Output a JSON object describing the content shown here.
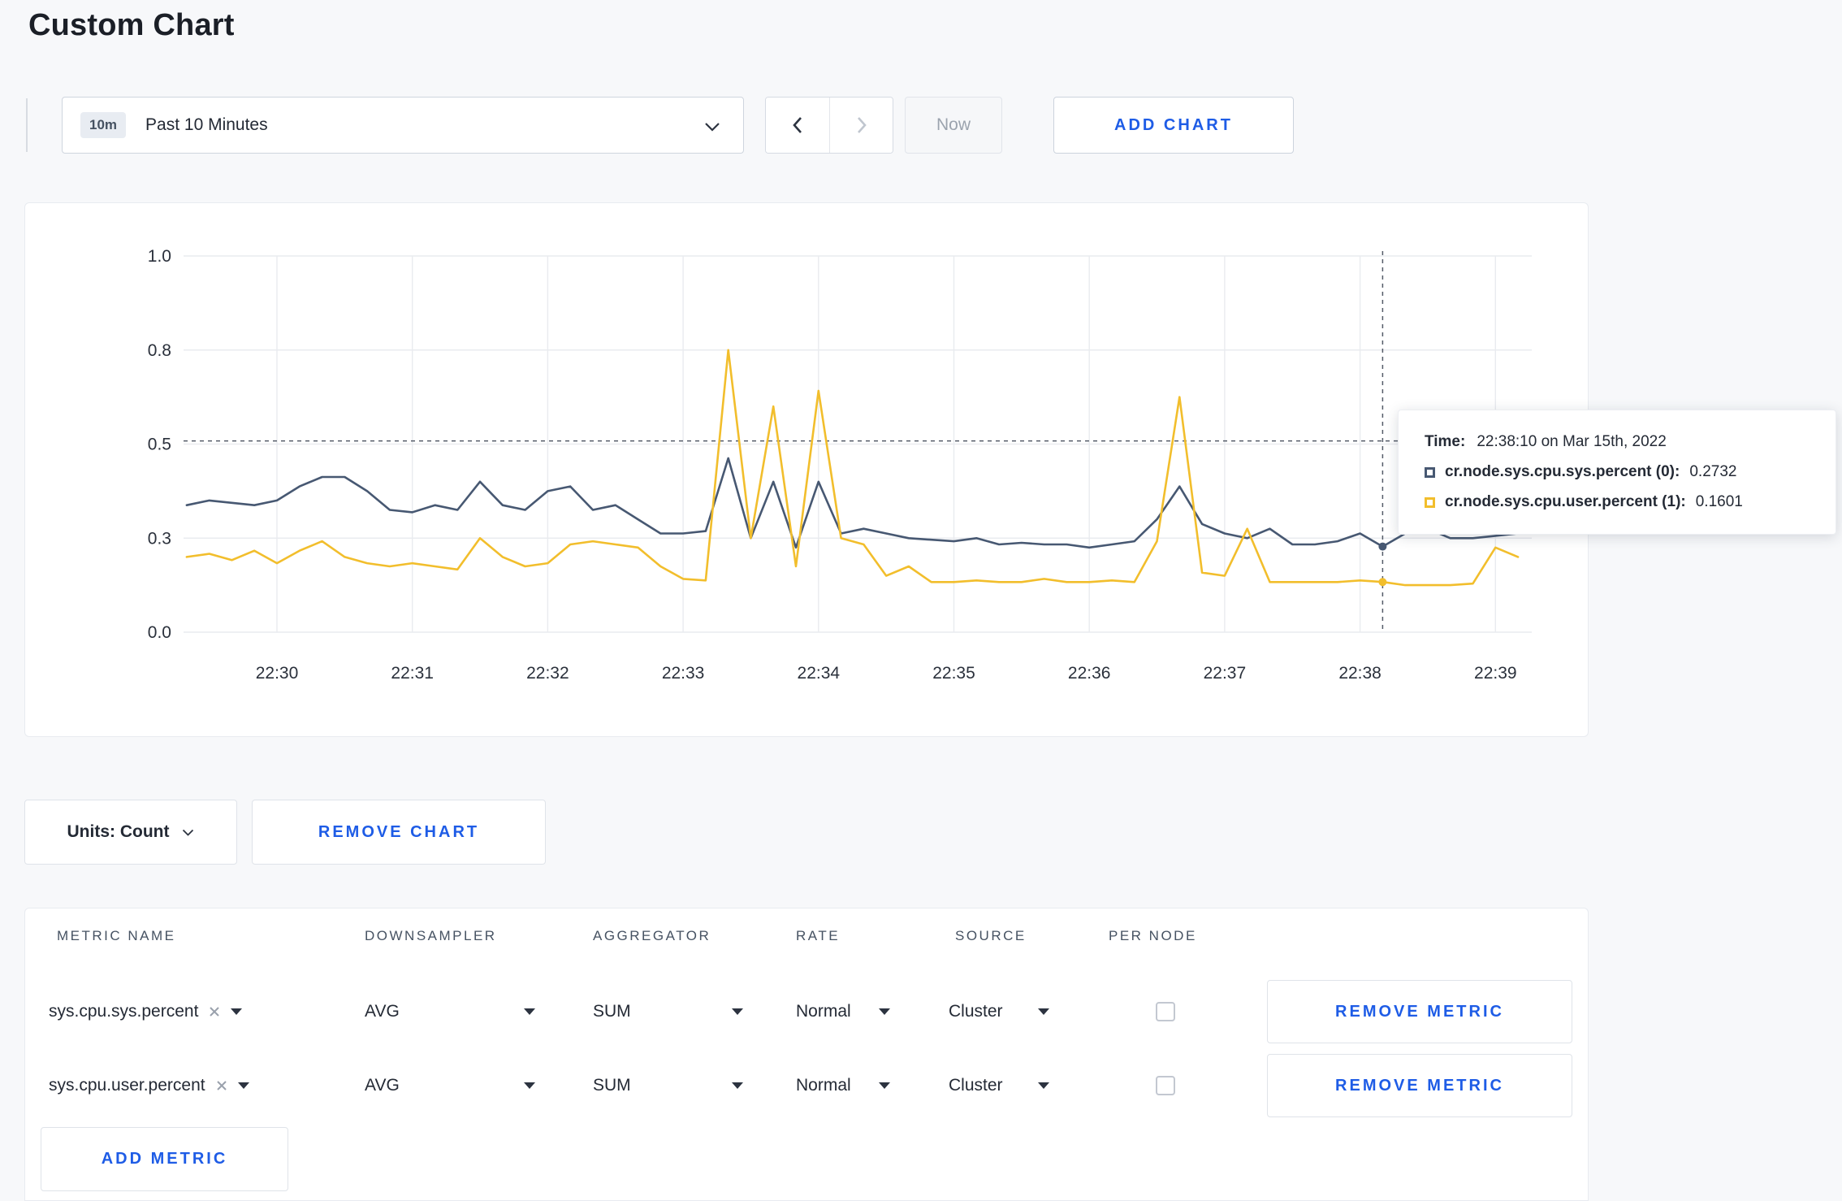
{
  "page": {
    "title": "Custom Chart"
  },
  "colors": {
    "accent": "#1e5ce6",
    "series_sys": "#475872",
    "series_user": "#f2be2c"
  },
  "toolbar": {
    "time_badge": "10m",
    "time_range": "Past 10 Minutes",
    "now_label": "Now",
    "add_chart_label": "ADD CHART"
  },
  "chart_controls": {
    "units_label": "Units: Count",
    "remove_chart_label": "REMOVE CHART"
  },
  "tooltip": {
    "time_label": "Time:",
    "time_value": "22:38:10 on Mar 15th, 2022",
    "series": [
      {
        "label": "cr.node.sys.cpu.sys.percent (0):",
        "value": "0.2732",
        "color": "#475872"
      },
      {
        "label": "cr.node.sys.cpu.user.percent (1):",
        "value": "0.1601",
        "color": "#f2be2c"
      }
    ]
  },
  "chart_data": {
    "type": "line",
    "title": "",
    "x_ticks": [
      "22:30",
      "22:31",
      "22:32",
      "22:33",
      "22:34",
      "22:35",
      "22:36",
      "22:37",
      "22:38",
      "22:39"
    ],
    "y_ticks": [
      0,
      0.3,
      0.5,
      0.8,
      1.0
    ],
    "ylim": [
      0,
      1.0
    ],
    "grid": true,
    "first_tick_index": 4,
    "points_per_minute": 6,
    "crosshair": {
      "minutes_from_first_tick": 8.1667,
      "point_index": 53,
      "threshold": 0.51
    },
    "series": [
      {
        "name": "cr.node.sys.cpu.sys.percent",
        "color": "#475872",
        "values": [
          0.37,
          0.38,
          0.375,
          0.37,
          0.38,
          0.41,
          0.43,
          0.43,
          0.4,
          0.36,
          0.355,
          0.37,
          0.36,
          0.42,
          0.37,
          0.36,
          0.4,
          0.41,
          0.36,
          0.37,
          0.34,
          0.31,
          0.31,
          0.315,
          0.47,
          0.3,
          0.42,
          0.27,
          0.42,
          0.31,
          0.32,
          0.31,
          0.3,
          0.295,
          0.29,
          0.3,
          0.28,
          0.285,
          0.28,
          0.28,
          0.27,
          0.28,
          0.29,
          0.34,
          0.41,
          0.33,
          0.31,
          0.3,
          0.32,
          0.28,
          0.28,
          0.29,
          0.31,
          0.2732,
          0.31,
          0.32,
          0.3,
          0.3,
          0.305,
          0.31
        ]
      },
      {
        "name": "cr.node.sys.cpu.user.percent",
        "color": "#f2be2c",
        "values": [
          0.24,
          0.25,
          0.23,
          0.26,
          0.22,
          0.26,
          0.29,
          0.24,
          0.22,
          0.21,
          0.22,
          0.21,
          0.2,
          0.3,
          0.24,
          0.21,
          0.22,
          0.28,
          0.29,
          0.28,
          0.27,
          0.21,
          0.17,
          0.165,
          0.8,
          0.3,
          0.62,
          0.21,
          0.67,
          0.3,
          0.28,
          0.18,
          0.21,
          0.16,
          0.16,
          0.165,
          0.16,
          0.16,
          0.17,
          0.16,
          0.16,
          0.165,
          0.16,
          0.29,
          0.65,
          0.19,
          0.18,
          0.32,
          0.16,
          0.16,
          0.16,
          0.16,
          0.165,
          0.1601,
          0.15,
          0.15,
          0.15,
          0.155,
          0.27,
          0.24
        ]
      }
    ]
  },
  "metrics_table": {
    "headers": [
      "METRIC NAME",
      "DOWNSAMPLER",
      "AGGREGATOR",
      "RATE",
      "SOURCE",
      "PER NODE"
    ],
    "rows": [
      {
        "metric": "sys.cpu.sys.percent",
        "downsampler": "AVG",
        "aggregator": "SUM",
        "rate": "Normal",
        "source": "Cluster",
        "per_node_checked": false,
        "remove_label": "REMOVE METRIC"
      },
      {
        "metric": "sys.cpu.user.percent",
        "downsampler": "AVG",
        "aggregator": "SUM",
        "rate": "Normal",
        "source": "Cluster",
        "per_node_checked": false,
        "remove_label": "REMOVE METRIC"
      }
    ],
    "add_metric_label": "ADD METRIC"
  }
}
